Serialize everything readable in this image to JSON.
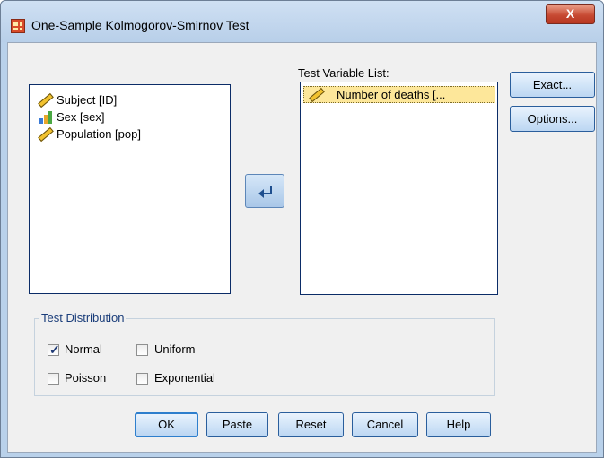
{
  "window": {
    "title": "One-Sample Kolmogorov-Smirnov Test",
    "close_label": "X"
  },
  "source_list": {
    "items": [
      {
        "label": "Subject [ID]",
        "icon": "ruler-scale-icon"
      },
      {
        "label": "Sex [sex]",
        "icon": "bar-nominal-icon"
      },
      {
        "label": "Population [pop]",
        "icon": "ruler-scale-icon"
      }
    ]
  },
  "move_button": {
    "icon": "move-arrow-icon"
  },
  "test_variable_list": {
    "label": "Test Variable List:",
    "items": [
      {
        "label": "Number of deaths [...",
        "icon": "ruler-scale-icon"
      }
    ]
  },
  "side_buttons": {
    "exact": "Exact...",
    "options": "Options..."
  },
  "test_distribution": {
    "legend": "Test Distribution",
    "normal": {
      "label": "Normal",
      "checked": true
    },
    "uniform": {
      "label": "Uniform",
      "checked": false
    },
    "poisson": {
      "label": "Poisson",
      "checked": false
    },
    "exponential": {
      "label": "Exponential",
      "checked": false
    }
  },
  "footer_buttons": {
    "ok": "OK",
    "paste": "Paste",
    "reset": "Reset",
    "cancel": "Cancel",
    "help": "Help"
  },
  "colors": {
    "accent": "#2e7fcd",
    "selection": "#fde79a"
  }
}
